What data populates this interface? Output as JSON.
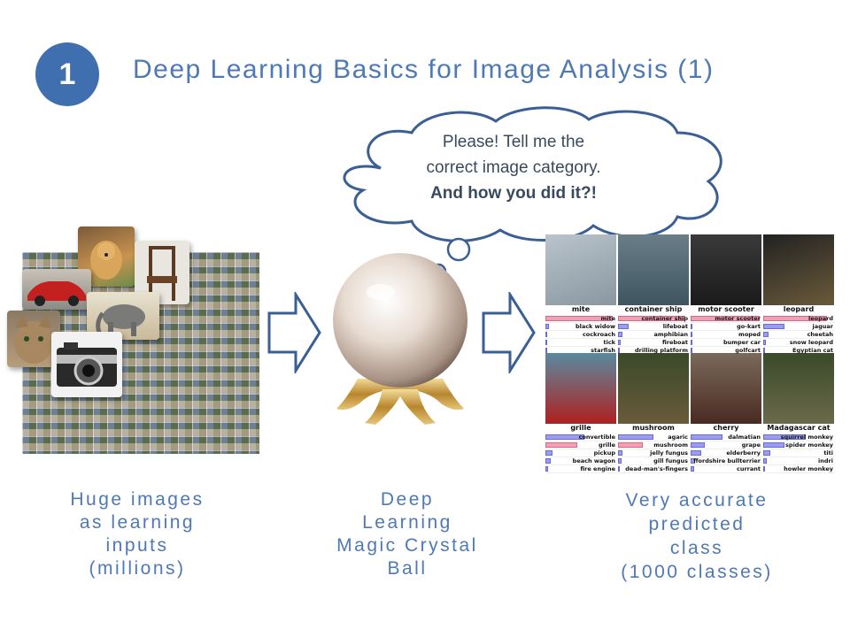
{
  "slide": {
    "number": "1",
    "title": "Deep Learning Basics for Image Analysis (1)"
  },
  "bubble": {
    "line1": "Please! Tell me the",
    "line2": "correct image category.",
    "line3": "And how you did it?!"
  },
  "captions": {
    "left": [
      "Huge images",
      "as learning",
      "inputs",
      "(millions)"
    ],
    "middle": [
      "Deep",
      "Learning",
      "Magic Crystal",
      "Ball"
    ],
    "right": [
      "Very accurate",
      "predicted",
      "class",
      "(1000 classes)"
    ]
  },
  "predictions": [
    {
      "label": "mite",
      "classes": [
        "mite",
        "black widow",
        "cockroach",
        "tick",
        "starfish"
      ],
      "scores": [
        0.95,
        0.05,
        0.03,
        0.02,
        0.01
      ]
    },
    {
      "label": "container ship",
      "classes": [
        "container ship",
        "lifeboat",
        "amphibian",
        "fireboat",
        "drilling platform"
      ],
      "scores": [
        0.95,
        0.15,
        0.06,
        0.04,
        0.03
      ]
    },
    {
      "label": "motor scooter",
      "classes": [
        "motor scooter",
        "go-kart",
        "moped",
        "bumper car",
        "golfcart"
      ],
      "scores": [
        0.98,
        0.03,
        0.03,
        0.02,
        0.01
      ]
    },
    {
      "label": "leopard",
      "classes": [
        "leopard",
        "jaguar",
        "cheetah",
        "snow leopard",
        "Egyptian cat"
      ],
      "scores": [
        0.9,
        0.3,
        0.08,
        0.04,
        0.02
      ]
    },
    {
      "label": "grille",
      "classes": [
        "convertible",
        "grille",
        "pickup",
        "beach wagon",
        "fire engine"
      ],
      "scores": [
        0.55,
        0.45,
        0.1,
        0.08,
        0.04
      ]
    },
    {
      "label": "mushroom",
      "classes": [
        "agaric",
        "mushroom",
        "jelly fungus",
        "gill fungus",
        "dead-man's-fingers"
      ],
      "scores": [
        0.5,
        0.35,
        0.06,
        0.05,
        0.02
      ]
    },
    {
      "label": "cherry",
      "classes": [
        "dalmatian",
        "grape",
        "elderberry",
        "ffordshire bullterrier",
        "currant"
      ],
      "scores": [
        0.45,
        0.2,
        0.15,
        0.06,
        0.05
      ]
    },
    {
      "label": "Madagascar cat",
      "classes": [
        "squirrel monkey",
        "spider monkey",
        "titi",
        "indri",
        "howler monkey"
      ],
      "scores": [
        0.6,
        0.3,
        0.1,
        0.05,
        0.03
      ]
    }
  ],
  "colors": {
    "accent": "#4f79b4",
    "badge": "#3f6fae",
    "bar": "#9b9cf4",
    "bar_top": "#f39fb5"
  }
}
